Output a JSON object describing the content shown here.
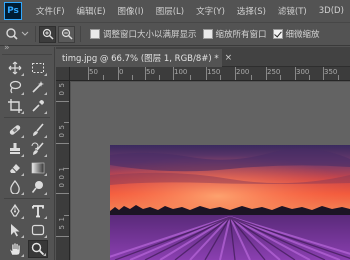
{
  "app": {
    "logo": "Ps"
  },
  "menu": [
    "文件(F)",
    "编辑(E)",
    "图像(I)",
    "图层(L)",
    "文字(Y)",
    "选择(S)",
    "滤镜(T)",
    "3D(D)"
  ],
  "options": {
    "tool_icon": "zoom-icon",
    "zoom_in_icon": "zoom-in-icon",
    "zoom_out_icon": "zoom-out-icon",
    "check1_label": "调整窗口大小以满屏显示",
    "check2_label": "缩放所有窗口",
    "check3_label": "细微缩放",
    "check1": false,
    "check2": false,
    "check3": true
  },
  "document": {
    "tab_title": "timg.jpg @ 66.7% (图层 1, RGB/8#) *",
    "close": "×"
  },
  "ruler": {
    "h_ticks": [
      "50",
      "0",
      "50",
      "100",
      "150",
      "200",
      "250",
      "300",
      "350",
      "400"
    ],
    "v_ticks": [
      "5",
      "0",
      "5",
      "0",
      "1",
      "0",
      "0",
      "1",
      "5"
    ]
  },
  "colors": {
    "sky_top": "#3a2a5e",
    "sky_glow": "#f25a3c",
    "lavender": "#8a3fb0"
  }
}
